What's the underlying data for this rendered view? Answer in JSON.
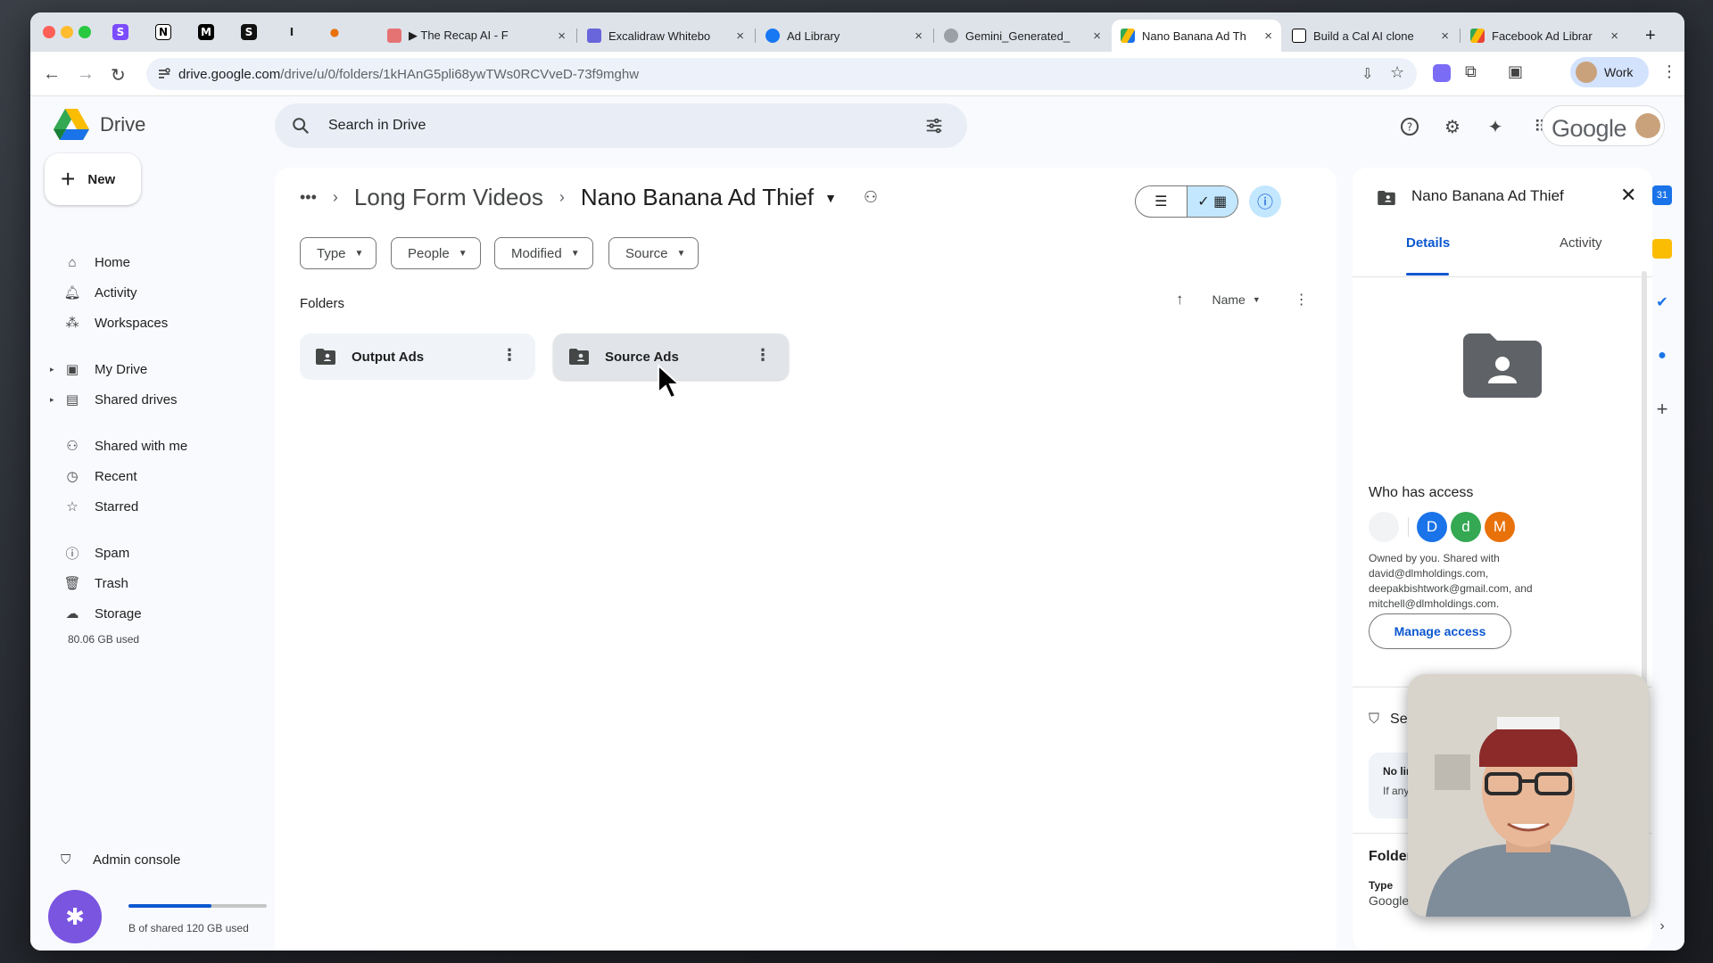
{
  "browser": {
    "tabs": [
      {
        "title": "▶ The Recap AI - F",
        "close": "×"
      },
      {
        "title": "Excalidraw Whitebo",
        "close": "×"
      },
      {
        "title": "Ad Library",
        "close": "×"
      },
      {
        "title": "Gemini_Generated_",
        "close": "×"
      },
      {
        "title": "Nano Banana Ad Th",
        "close": "×"
      },
      {
        "title": "Build a Cal AI clone",
        "close": "×"
      },
      {
        "title": "Facebook Ad Librar",
        "close": "×"
      }
    ],
    "pinned": [
      "S",
      "N",
      "M",
      "S",
      "I",
      "●"
    ],
    "new_tab": "+",
    "url_host": "drive.google.com",
    "url_path": "/drive/u/0/folders/1kHAnG5pli68ywTWs0RCVveD-73f9mghw",
    "profile_label": "Work"
  },
  "drive": {
    "app_name": "Drive",
    "search_placeholder": "Search in Drive",
    "google_label": "Google",
    "new_label": "New",
    "nav": [
      {
        "label": "Home"
      },
      {
        "label": "Activity"
      },
      {
        "label": "Workspaces"
      },
      {
        "label": "My Drive"
      },
      {
        "label": "Shared drives"
      },
      {
        "label": "Shared with me"
      },
      {
        "label": "Recent"
      },
      {
        "label": "Starred"
      },
      {
        "label": "Spam"
      },
      {
        "label": "Trash"
      },
      {
        "label": "Storage"
      }
    ],
    "storage_used": "80.06 GB used",
    "admin_console": "Admin console",
    "shared_quota": "B of shared 120 GB used",
    "shared_quota_fraction": 0.6,
    "breadcrumb": {
      "more": "•••",
      "parent": "Long Form Videos",
      "current": "Nano Banana Ad Thief"
    },
    "filters": [
      "Type",
      "People",
      "Modified",
      "Source"
    ],
    "section_title": "Folders",
    "sort_label": "Name",
    "folders": [
      {
        "name": "Output Ads"
      },
      {
        "name": "Source Ads"
      }
    ]
  },
  "details": {
    "title": "Nano Banana Ad Thief",
    "tabs": [
      "Details",
      "Activity"
    ],
    "who_has_access": "Who has access",
    "avatars": [
      {
        "letter": "D",
        "color": "#1a73e8"
      },
      {
        "letter": "d",
        "color": "#34a853"
      },
      {
        "letter": "M",
        "color": "#e8710a"
      }
    ],
    "owned_text": "Owned by you. Shared with david@dlmholdings.com, deepakbishtwork@gmail.com, and mitchell@dlmholdings.com.",
    "manage_access": "Manage access",
    "security_title": "Secur",
    "security_line1": "No limitat",
    "security_line2": "If any are",
    "folder_details_title": "Folder de",
    "type_label": "Type",
    "type_value": "Google Drive F"
  },
  "colors": {
    "accent": "#0b57d0",
    "selected": "#c2e7ff"
  }
}
